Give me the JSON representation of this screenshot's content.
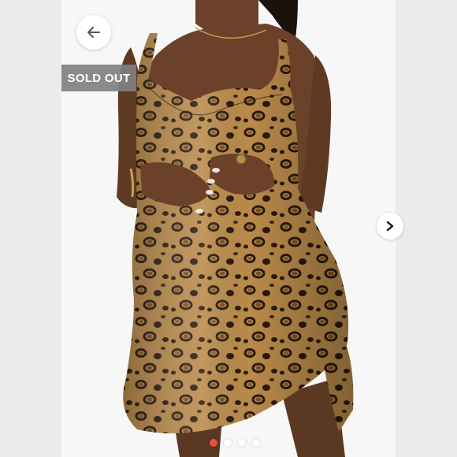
{
  "listing": {
    "status_badge": "SOLD OUT",
    "image_count": 4,
    "active_image_index": 0
  },
  "icons": {
    "back": "arrow-left-icon",
    "next": "chevron-right-icon"
  },
  "colors": {
    "badge_bg": "#808080",
    "active_dot": "#e3513f",
    "inactive_dot": "#ffffff"
  }
}
